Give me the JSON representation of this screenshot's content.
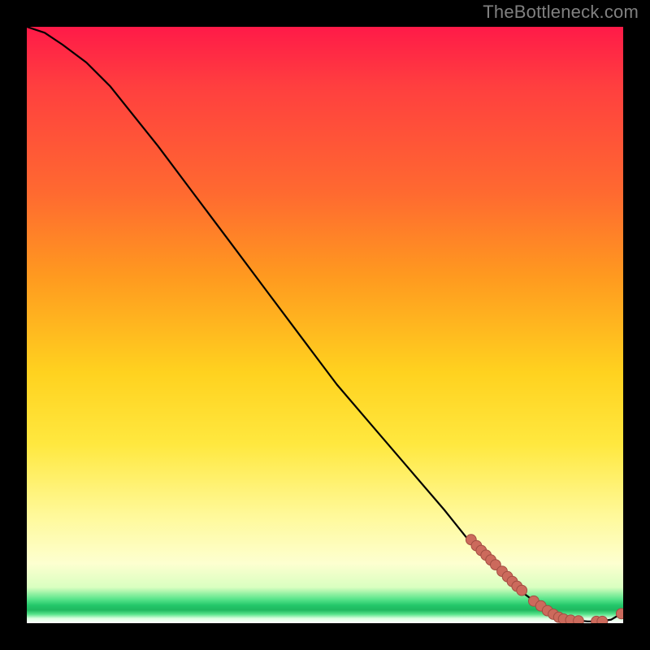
{
  "watermark": "TheBottleneck.com",
  "chart_data": {
    "type": "line",
    "title": "",
    "xlabel": "",
    "ylabel": "",
    "xlim": [
      0,
      100
    ],
    "ylim": [
      0,
      100
    ],
    "grid": false,
    "legend": false,
    "series": [
      {
        "name": "curve",
        "style": "line",
        "color": "#000000",
        "x": [
          0,
          3,
          6,
          10,
          14,
          18,
          22,
          28,
          34,
          40,
          46,
          52,
          58,
          64,
          70,
          74,
          78,
          82,
          86,
          88,
          90,
          92,
          94,
          96,
          98,
          100
        ],
        "y": [
          100,
          99,
          97,
          94,
          90,
          85,
          80,
          72,
          64,
          56,
          48,
          40,
          33,
          26,
          19,
          14,
          10,
          6,
          3,
          1.6,
          0.9,
          0.5,
          0.3,
          0.3,
          0.6,
          1.8
        ]
      },
      {
        "name": "highlight-points",
        "style": "scatter",
        "color": "#cc6a5c",
        "x": [
          74.5,
          75.4,
          76.2,
          77.0,
          77.8,
          78.6,
          79.7,
          80.6,
          81.4,
          82.2,
          83.0,
          85.0,
          86.2,
          87.3,
          88.3,
          89.2,
          90.0,
          91.2,
          92.5,
          95.5,
          96.5,
          99.7
        ],
        "y": [
          14.0,
          13.0,
          12.2,
          11.4,
          10.6,
          9.8,
          8.7,
          7.8,
          7.0,
          6.2,
          5.5,
          3.7,
          2.9,
          2.1,
          1.5,
          1.0,
          0.7,
          0.5,
          0.4,
          0.3,
          0.3,
          1.6
        ]
      }
    ],
    "background_gradient": {
      "direction": "vertical",
      "stops": [
        {
          "pos": 0.0,
          "color": "#ff1a48"
        },
        {
          "pos": 0.42,
          "color": "#ff9a1f"
        },
        {
          "pos": 0.7,
          "color": "#ffe83f"
        },
        {
          "pos": 0.9,
          "color": "#fdffd0"
        },
        {
          "pos": 0.97,
          "color": "#1fb85f"
        },
        {
          "pos": 1.0,
          "color": "#ffffff"
        }
      ]
    }
  }
}
